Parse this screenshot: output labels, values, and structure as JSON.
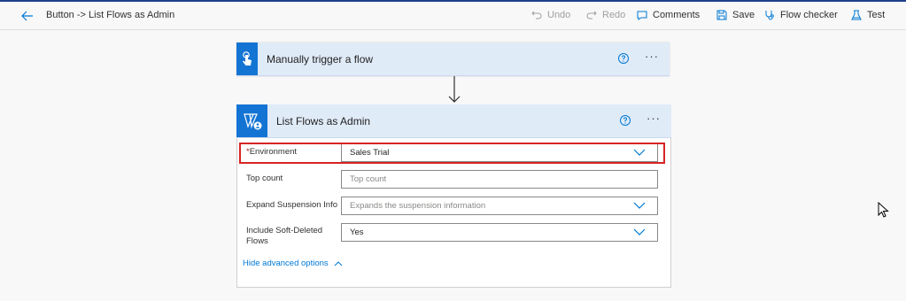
{
  "header": {
    "flow_title": "Button -> List Flows as Admin",
    "toolbar": {
      "undo": "Undo",
      "redo": "Redo",
      "comments": "Comments",
      "save": "Save",
      "flow_checker": "Flow checker",
      "test": "Test"
    }
  },
  "trigger_card": {
    "title": "Manually trigger a flow",
    "more": "···"
  },
  "action_card": {
    "title": "List Flows as Admin",
    "more": "···",
    "fields": {
      "environment": {
        "required_mark": "*",
        "label": "Environment",
        "value": "Sales Trial"
      },
      "top_count": {
        "label": "Top count",
        "placeholder": "Top count"
      },
      "expand_suspension": {
        "label": "Expand Suspension Info",
        "placeholder": "Expands the suspension information"
      },
      "include_soft_deleted": {
        "label_line1": "Include Soft-Deleted",
        "label_line2": "Flows",
        "value": "Yes"
      }
    },
    "hide_advanced": "Hide advanced options"
  },
  "colors": {
    "accent": "#0078d4",
    "header_band": "#e0ebf8",
    "tile": "#1474d4",
    "highlight": "#d62424"
  }
}
